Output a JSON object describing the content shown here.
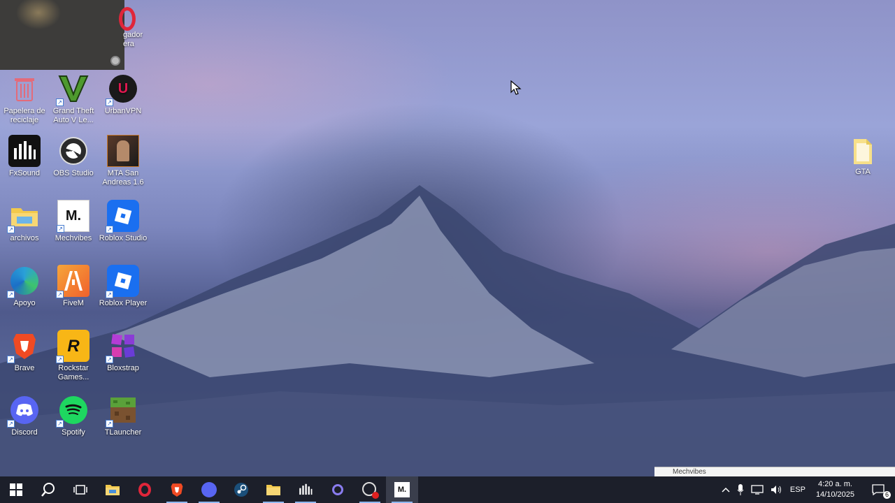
{
  "desktop": {
    "icons": [
      {
        "label": "Papelera de reciclaje",
        "icon": "recycle-bin-icon"
      },
      {
        "label": "Grand Theft Auto V Le...",
        "icon": "gta-v-icon"
      },
      {
        "label": "UrbanVPN",
        "icon": "urbanvpn-icon"
      },
      {
        "label": "FxSound",
        "icon": "fxsound-icon"
      },
      {
        "label": "OBS Studio",
        "icon": "obs-icon"
      },
      {
        "label": "MTA San Andreas 1.6",
        "icon": "mta-icon"
      },
      {
        "label": "archivos",
        "icon": "folder-icon"
      },
      {
        "label": "Mechvibes",
        "icon": "mechvibes-icon"
      },
      {
        "label": "Roblox Studio",
        "icon": "roblox-studio-icon"
      },
      {
        "label": "Apoyo",
        "icon": "edge-icon"
      },
      {
        "label": "FiveM",
        "icon": "fivem-icon"
      },
      {
        "label": "Roblox Player",
        "icon": "roblox-player-icon"
      },
      {
        "label": "Brave",
        "icon": "brave-icon"
      },
      {
        "label": "Rockstar Games...",
        "icon": "rockstar-icon"
      },
      {
        "label": "Bloxstrap",
        "icon": "bloxstrap-icon"
      },
      {
        "label": "Discord",
        "icon": "discord-icon"
      },
      {
        "label": "Spotify",
        "icon": "spotify-icon"
      },
      {
        "label": "TLauncher",
        "icon": "tlauncher-icon"
      }
    ],
    "opera_partial_label": "gador\nera",
    "gta_folder": "GTA"
  },
  "taskbar": {
    "language": "ESP",
    "time": "4:20 a. m.",
    "date": "14/10/2025",
    "notification_count": "6",
    "preview_title": "Mechvibes"
  },
  "colors": {
    "taskbar_bg": "#1c1f2a",
    "accent": "#8fb8f0"
  }
}
